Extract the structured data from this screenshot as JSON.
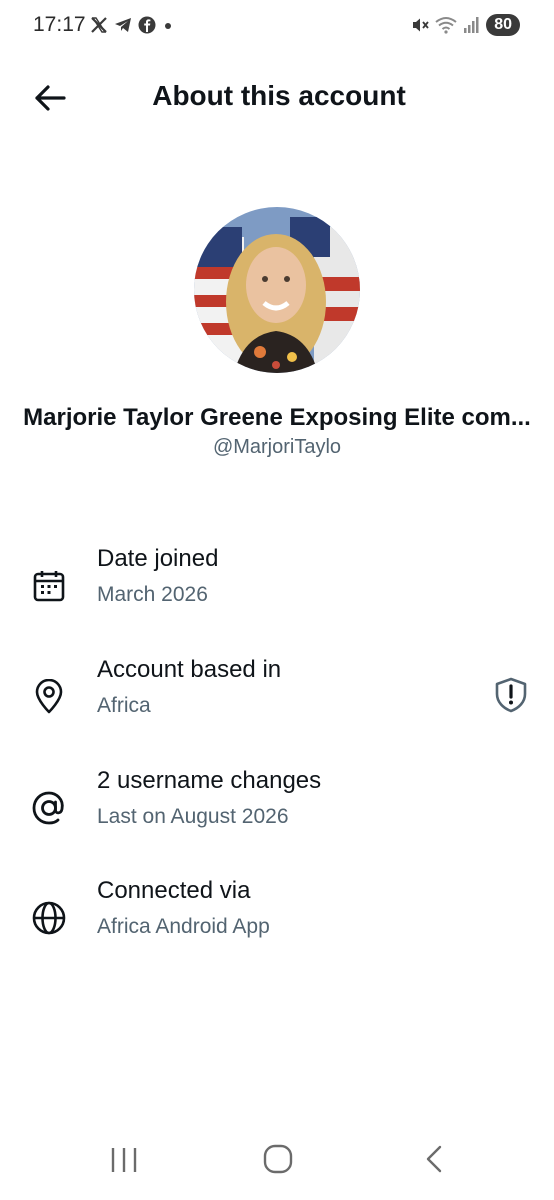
{
  "status_bar": {
    "time": "17:17",
    "battery": "80"
  },
  "header": {
    "title": "About this account"
  },
  "profile": {
    "name": "Marjorie Taylor Greene Exposing Elite com...",
    "handle": "@MarjoriTaylo"
  },
  "info": [
    {
      "icon": "calendar-icon",
      "label": "Date joined",
      "value": "March 2026"
    },
    {
      "icon": "location-pin-icon",
      "label": "Account based in",
      "value": "Africa"
    },
    {
      "icon": "at-sign-icon",
      "label": "2 username changes",
      "value": "Last on August 2026"
    },
    {
      "icon": "globe-icon",
      "label": "Connected via",
      "value": "Africa Android App"
    }
  ],
  "colors": {
    "primary_text": "#0f1419",
    "secondary_text": "#536471",
    "background": "#ffffff"
  }
}
